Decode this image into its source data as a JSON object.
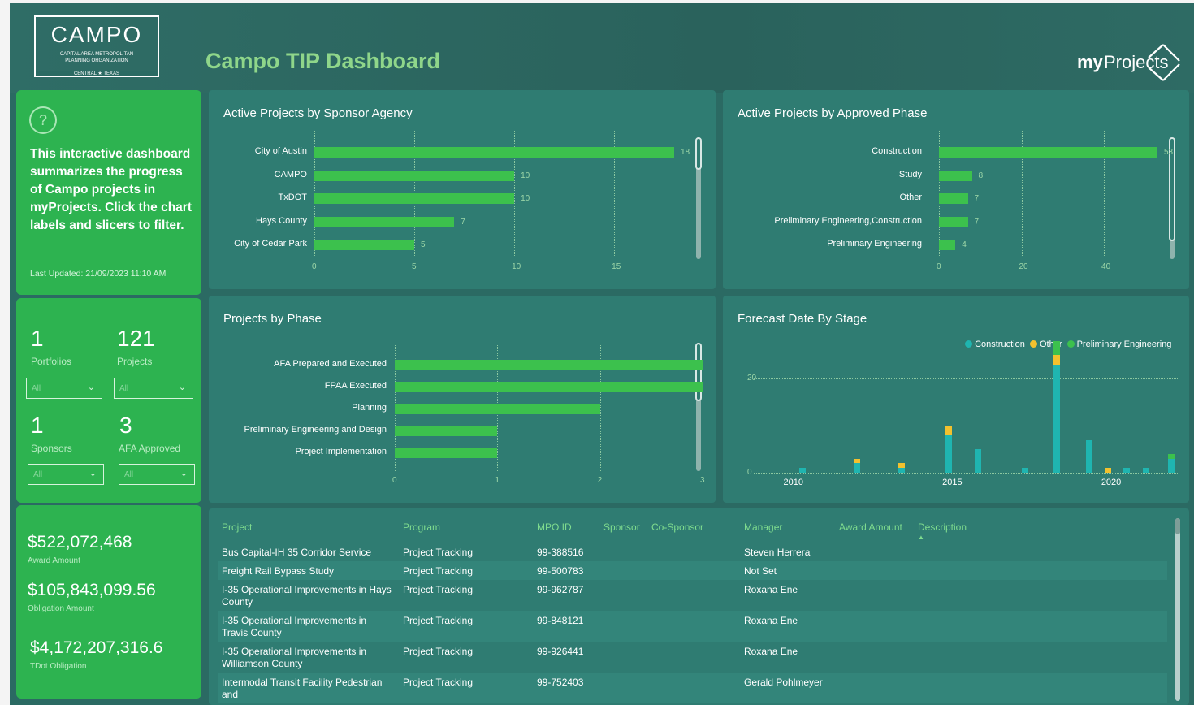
{
  "header": {
    "logo_main": "CAMPO",
    "logo_sub1": "CAPITAL AREA METROPOLITAN",
    "logo_sub2": "PLANNING ORGANIZATION",
    "logo_sub3": "CENTRAL ★ TEXAS",
    "title": "Campo TIP Dashboard",
    "brand_left": "my",
    "brand_right": "Projects"
  },
  "info": {
    "text": "This interactive dashboard summarizes the progress of Campo projects in myProjects. Click the chart labels and slicers to filter.",
    "updated": "Last Updated: 21/09/2023 11:10 AM"
  },
  "kpis": [
    {
      "value": "1",
      "label": "Portfolios",
      "slicer": "All"
    },
    {
      "value": "121",
      "label": "Projects",
      "slicer": "All"
    },
    {
      "value": "1",
      "label": "Sponsors",
      "slicer": "All"
    },
    {
      "value": "3",
      "label": "AFA Approved",
      "slicer": "All"
    }
  ],
  "money": [
    {
      "value": "$522,072,468",
      "label": "Award Amount"
    },
    {
      "value": "$105,843,099.56",
      "label": "Obligation Amount"
    },
    {
      "value": "$4,172,207,316.6",
      "label": "TDot Obligation"
    }
  ],
  "colors": {
    "bar": "#3cc14d",
    "construction": "#1fb5b0",
    "other": "#f2c12e",
    "prelim": "#3cc14d"
  },
  "chart_data": [
    {
      "type": "bar",
      "title": "Active Projects by Sponsor Agency",
      "orientation": "horizontal",
      "categories": [
        "City of Austin",
        "CAMPO",
        "TxDOT",
        "Hays County",
        "City of Cedar Park"
      ],
      "values": [
        18,
        10,
        10,
        7,
        5
      ],
      "xlim": [
        0,
        18
      ],
      "xticks": [
        "0",
        "5",
        "10",
        "15"
      ]
    },
    {
      "type": "bar",
      "title": "Active Projects by Approved Phase",
      "orientation": "horizontal",
      "categories": [
        "Construction",
        "Study",
        "Other",
        "Preliminary Engineering,Construction",
        "Preliminary Engineering"
      ],
      "values": [
        53,
        8,
        7,
        7,
        4
      ],
      "xlim": [
        0,
        53
      ],
      "xticks": [
        "0",
        "20",
        "40"
      ]
    },
    {
      "type": "bar",
      "title": "Projects by Phase",
      "orientation": "horizontal",
      "categories": [
        "AFA Prepared and Executed",
        "FPAA Executed",
        "Planning",
        "Preliminary Engineering and Design",
        "Project Implementation"
      ],
      "values": [
        3,
        3,
        2,
        1,
        1
      ],
      "xlim": [
        0,
        3
      ],
      "xticks": [
        "0",
        "1",
        "2",
        "3"
      ]
    },
    {
      "type": "bar",
      "title": "Forecast Date By Stage",
      "stacked": true,
      "legend": [
        "Construction",
        "Other",
        "Preliminary Engineering"
      ],
      "xticks": [
        "2010",
        "2015",
        "2020"
      ],
      "yticks": [
        "0",
        "20"
      ],
      "ylim": [
        0,
        28
      ],
      "points": [
        {
          "x": 2010.2,
          "construction": 1,
          "other": 0,
          "prelim": 0
        },
        {
          "x": 2011.9,
          "construction": 2,
          "other": 1,
          "prelim": 0
        },
        {
          "x": 2013.3,
          "construction": 1,
          "other": 1,
          "prelim": 0
        },
        {
          "x": 2014.8,
          "construction": 8,
          "other": 2,
          "prelim": 0
        },
        {
          "x": 2015.7,
          "construction": 5,
          "other": 0,
          "prelim": 0
        },
        {
          "x": 2017.2,
          "construction": 1,
          "other": 0,
          "prelim": 0
        },
        {
          "x": 2018.2,
          "construction": 23,
          "other": 2,
          "prelim": 3
        },
        {
          "x": 2019.2,
          "construction": 7,
          "other": 0,
          "prelim": 0
        },
        {
          "x": 2019.8,
          "construction": 0,
          "other": 1,
          "prelim": 0
        },
        {
          "x": 2020.4,
          "construction": 1,
          "other": 0,
          "prelim": 0
        },
        {
          "x": 2021.0,
          "construction": 1,
          "other": 0,
          "prelim": 0
        },
        {
          "x": 2021.8,
          "construction": 3,
          "other": 0,
          "prelim": 1
        }
      ]
    }
  ],
  "table": {
    "columns": [
      "Project",
      "Program",
      "MPO ID",
      "Sponsor",
      "Co-Sponsor",
      "Manager",
      "Award Amount",
      "Description"
    ],
    "rows": [
      [
        "Bus Capital-IH 35 Corridor Service",
        "Project Tracking",
        "99-388516",
        "Steven Herrera"
      ],
      [
        "Freight Rail Bypass Study",
        "Project Tracking",
        "99-500783",
        "Not Set"
      ],
      [
        "I-35 Operational Improvements in Hays County",
        "Project Tracking",
        "99-962787",
        "Roxana Ene"
      ],
      [
        "I-35 Operational Improvements in Travis County",
        "Project Tracking",
        "99-848121",
        "Roxana Ene"
      ],
      [
        "I-35 Operational Improvements in Williamson County",
        "Project Tracking",
        "99-926441",
        "Roxana Ene"
      ],
      [
        "Intermodal Transit Facility Pedestrian and",
        "Project Tracking",
        "99-752403",
        "Gerald Pohlmeyer"
      ]
    ]
  }
}
